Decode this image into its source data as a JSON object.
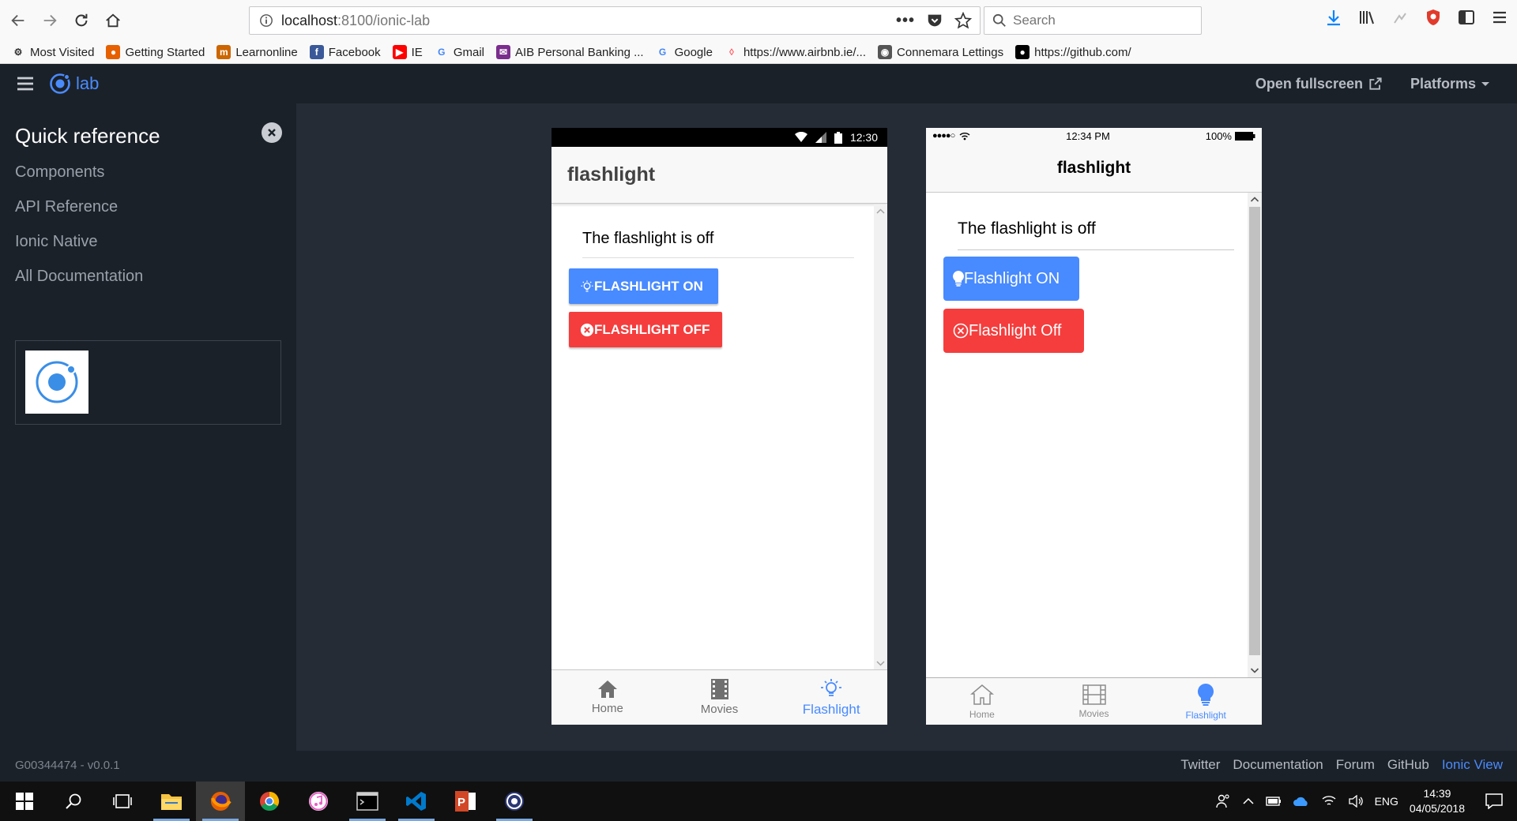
{
  "browser": {
    "url_host": "localhost",
    "url_path": ":8100/ionic-lab",
    "search_placeholder": "Search",
    "bookmarks": [
      {
        "label": "Most Visited",
        "icon": "gear-icon",
        "color": "#333333"
      },
      {
        "label": "Getting Started",
        "icon": "firefox-icon",
        "color": "#e66000"
      },
      {
        "label": "Learnonline",
        "icon": "learnonline-icon",
        "color": "#cc6600"
      },
      {
        "label": "Facebook",
        "icon": "facebook-icon",
        "color": "#3b5998"
      },
      {
        "label": "IE",
        "icon": "youtube-icon",
        "color": "#ff0000"
      },
      {
        "label": "Gmail",
        "icon": "google-icon",
        "color": "#4285f4"
      },
      {
        "label": "AIB Personal Banking ...",
        "icon": "aib-icon",
        "color": "#7b2d8e"
      },
      {
        "label": "Google",
        "icon": "google-icon",
        "color": "#4285f4"
      },
      {
        "label": "https://www.airbnb.ie/...",
        "icon": "airbnb-icon",
        "color": "#ff5a5f"
      },
      {
        "label": "Connemara Lettings",
        "icon": "globe-icon",
        "color": "#555555"
      },
      {
        "label": "https://github.com/",
        "icon": "github-icon",
        "color": "#000000"
      }
    ]
  },
  "lab": {
    "logo_text": "lab",
    "open_fullscreen": "Open fullscreen",
    "platforms": "Platforms",
    "sidebar": {
      "title": "Quick reference",
      "links": [
        "Components",
        "API Reference",
        "Ionic Native",
        "All Documentation"
      ]
    },
    "version": "G00344474 - v0.0.1",
    "footer_links": [
      "Twitter",
      "Documentation",
      "Forum",
      "GitHub",
      "Ionic View"
    ],
    "accent": "#4a8bfc"
  },
  "android": {
    "time": "12:30",
    "title": "flashlight",
    "status_text": "The flashlight is off",
    "btn_on": "FLASHLIGHT ON",
    "btn_off": "FLASHLIGHT OFF",
    "tabs": [
      "Home",
      "Movies",
      "Flashlight"
    ]
  },
  "ios": {
    "time": "12:34 PM",
    "battery": "100%",
    "title": "flashlight",
    "status_text": "The flashlight is off",
    "btn_on": "Flashlight ON",
    "btn_off": "Flashlight Off",
    "tabs": [
      "Home",
      "Movies",
      "Flashlight"
    ]
  },
  "colors": {
    "primary": "#488aff",
    "danger": "#f53d3d"
  },
  "taskbar": {
    "language": "ENG",
    "time": "14:39",
    "date": "04/05/2018"
  }
}
